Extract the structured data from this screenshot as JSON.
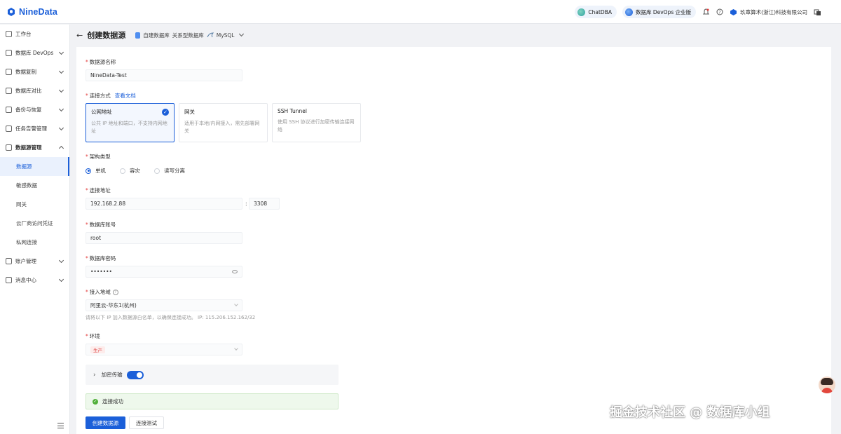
{
  "app": {
    "name": "NineData"
  },
  "header": {
    "chatdba": "ChatDBA",
    "edition": "数据库 DevOps 企业版",
    "company": "玖章算术(浙江)科技有限公司"
  },
  "sidebar": {
    "items": [
      {
        "label": "工作台",
        "icon": "home-icon"
      },
      {
        "label": "数据库 DevOps",
        "icon": "devops-icon"
      },
      {
        "label": "数据复制",
        "icon": "replicate-icon"
      },
      {
        "label": "数据库对比",
        "icon": "compare-icon"
      },
      {
        "label": "备份与恢复",
        "icon": "backup-icon"
      },
      {
        "label": "任务告警管理",
        "icon": "alarm-icon"
      },
      {
        "label": "数据源管理",
        "icon": "datasource-icon"
      }
    ],
    "sub_items": [
      "数据源",
      "敏感数据",
      "网关",
      "云厂商访问凭证",
      "私网连接"
    ],
    "bottom_items": [
      {
        "label": "账户管理",
        "icon": "account-icon"
      },
      {
        "label": "消息中心",
        "icon": "message-icon"
      }
    ]
  },
  "page": {
    "title": "创建数据源",
    "crumb_1": "自建数据库",
    "crumb_2": "关系型数据库",
    "crumb_3": "MySQL"
  },
  "form": {
    "name_label": "数据源名称",
    "name_value": "NineData-Test",
    "conn_label": "连接方式",
    "doc_link": "查看文档",
    "conn_options": [
      {
        "title": "公网地址",
        "desc": "公共 IP 地址和端口，不支持内网地址"
      },
      {
        "title": "网关",
        "desc": "适用于本地/内网接入，需先部署网关"
      },
      {
        "title": "SSH Tunnel",
        "desc": "使用 SSH 协议进行加密传输连接网络"
      }
    ],
    "arch_label": "架构类型",
    "arch_options": [
      "单机",
      "容灾",
      "读写分离"
    ],
    "address_label": "连接地址",
    "host_value": "192.168.2.88",
    "port_value": "3308",
    "account_label": "数据库账号",
    "account_value": "root",
    "password_label": "数据库密码",
    "password_value": "•••••••",
    "region_label": "接入地域",
    "region_value": "阿里云-华东1(杭州)",
    "whitelist_hint": "请将以下 IP 加入数据源白名单，以确保连接成功。 IP: 115.206.152.162/32",
    "env_label": "环境",
    "env_value": "生产",
    "encrypt_label": "加密传输",
    "success_text": "连接成功",
    "create_button": "创建数据源",
    "test_button": "连接测试"
  },
  "watermark": "掘金技术社区 @ 数据库小组",
  "colors": {
    "accent": "#1b5fd9",
    "success": "#52b03b",
    "danger": "#e23b3b"
  }
}
